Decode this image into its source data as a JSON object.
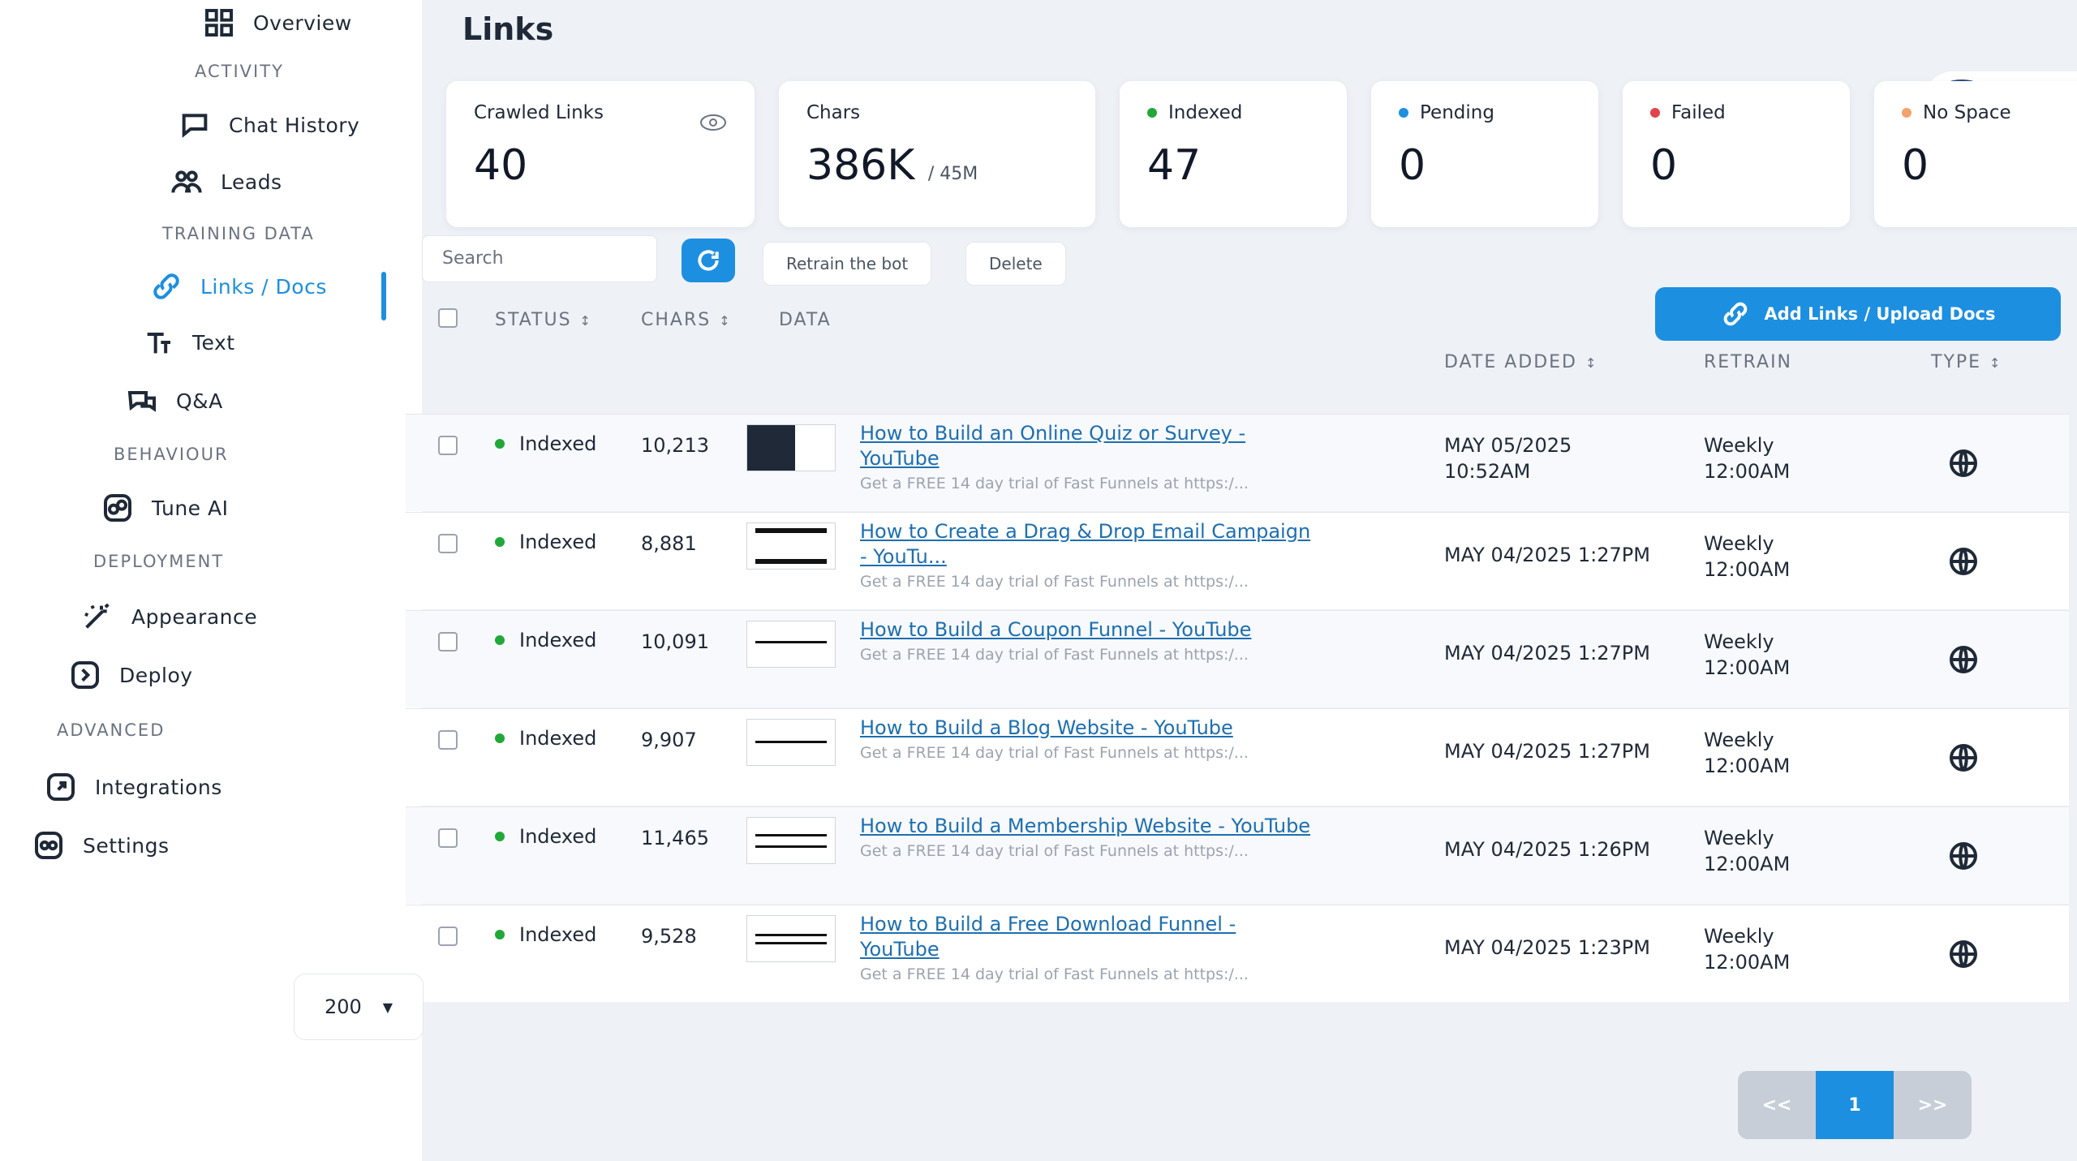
{
  "sidebar": {
    "items": [
      {
        "label": "Overview",
        "icon": "grid-icon"
      },
      {
        "label": "Chat History",
        "icon": "chat-icon"
      },
      {
        "label": "Leads",
        "icon": "users-icon"
      },
      {
        "label": "Links / Docs",
        "icon": "link-icon"
      },
      {
        "label": "Text",
        "icon": "text-icon"
      },
      {
        "label": "Q&A",
        "icon": "qa-icon"
      },
      {
        "label": "Tune AI",
        "icon": "tune-icon"
      },
      {
        "label": "Appearance",
        "icon": "wand-icon"
      },
      {
        "label": "Deploy",
        "icon": "deploy-icon"
      },
      {
        "label": "Integrations",
        "icon": "integrations-icon"
      },
      {
        "label": "Settings",
        "icon": "settings-icon"
      }
    ],
    "sections": [
      "ACTIVITY",
      "TRAINING DATA",
      "BEHAVIOUR",
      "DEPLOYMENT",
      "ADVANCED"
    ]
  },
  "page": {
    "title": "Links"
  },
  "stats": {
    "crawled": {
      "label": "Crawled Links",
      "value": "40"
    },
    "chars": {
      "label": "Chars",
      "value": "386K",
      "limit": "/ 45M"
    },
    "indexed": {
      "label": "Indexed",
      "value": "47",
      "color": "#22a83a"
    },
    "pending": {
      "label": "Pending",
      "value": "0",
      "color": "#1d8fe0"
    },
    "failed": {
      "label": "Failed",
      "value": "0",
      "color": "#e0454d"
    },
    "nospace": {
      "label": "No Space",
      "value": "0",
      "color": "#f2a36b"
    }
  },
  "toolbar": {
    "search_placeholder": "Search",
    "retrain_label": "Retrain the bot",
    "delete_label": "Delete",
    "add_label": "Add Links / Upload Docs"
  },
  "table": {
    "headers": {
      "status": "STATUS",
      "chars": "CHARS",
      "data": "DATA",
      "date": "DATE ADDED",
      "retrain": "RETRAIN",
      "type": "TYPE"
    },
    "rows": [
      {
        "status": "Indexed",
        "chars": "10,213",
        "title": "How to Build an Online Quiz or Survey - YouTube",
        "desc": "Get a FREE 14 day trial of Fast Funnels at https:/...",
        "date": "MAY 05/2025",
        "time": "10:52AM",
        "retrain": "Weekly",
        "retrain_time": "12:00AM"
      },
      {
        "status": "Indexed",
        "chars": "8,881",
        "title": "How to Create a Drag & Drop Email Campaign - YouTu...",
        "desc": "Get a FREE 14 day trial of Fast Funnels at https:/...",
        "date": "MAY 04/2025 1:27PM",
        "time": "",
        "retrain": "Weekly",
        "retrain_time": "12:00AM"
      },
      {
        "status": "Indexed",
        "chars": "10,091",
        "title": "How to Build a Coupon Funnel - YouTube",
        "desc": "Get a FREE 14 day trial of Fast Funnels at https:/...",
        "date": "MAY 04/2025 1:27PM",
        "time": "",
        "retrain": "Weekly",
        "retrain_time": "12:00AM"
      },
      {
        "status": "Indexed",
        "chars": "9,907",
        "title": "How to Build a Blog Website - YouTube",
        "desc": "Get a FREE 14 day trial of Fast Funnels at https:/...",
        "date": "MAY 04/2025 1:27PM",
        "time": "",
        "retrain": "Weekly",
        "retrain_time": "12:00AM"
      },
      {
        "status": "Indexed",
        "chars": "11,465",
        "title": "How to Build a Membership Website - YouTube",
        "desc": "Get a FREE 14 day trial of Fast Funnels at https:/...",
        "date": "MAY 04/2025 1:26PM",
        "time": "",
        "retrain": "Weekly",
        "retrain_time": "12:00AM"
      },
      {
        "status": "Indexed",
        "chars": "9,528",
        "title": "How to Build a Free Download Funnel - YouTube",
        "desc": "Get a FREE 14 day trial of Fast Funnels at https:/...",
        "date": "MAY 04/2025 1:23PM",
        "time": "",
        "retrain": "Weekly",
        "retrain_time": "12:00AM"
      }
    ]
  },
  "pagination": {
    "per_page": "200",
    "prev": "<<",
    "current": "1",
    "next": ">>"
  }
}
